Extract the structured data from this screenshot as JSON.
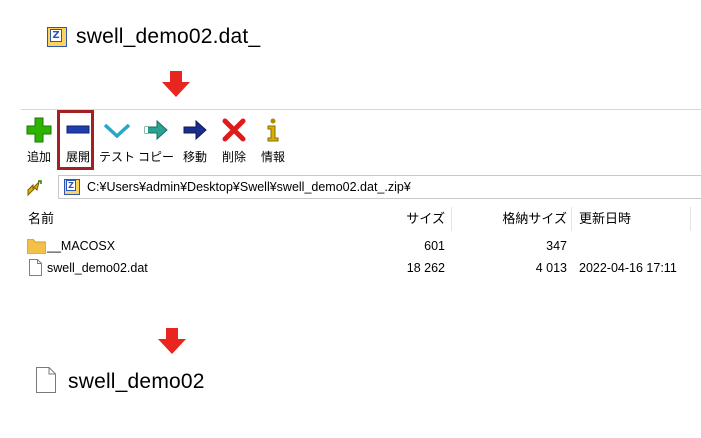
{
  "top_archive": {
    "filename": "swell_demo02.dat_"
  },
  "toolbar": {
    "buttons": [
      {
        "label": "追加",
        "icon": "add-plus-icon"
      },
      {
        "label": "展開",
        "icon": "extract-minus-icon"
      },
      {
        "label": "テスト",
        "icon": "test-check-icon"
      },
      {
        "label": "コピー",
        "icon": "copy-arrow-icon"
      },
      {
        "label": "移動",
        "icon": "move-arrow-icon"
      },
      {
        "label": "削除",
        "icon": "delete-x-icon"
      },
      {
        "label": "情報",
        "icon": "info-icon"
      }
    ],
    "highlighted_button": "展開",
    "highlight_color": "#a31f24"
  },
  "address_bar": {
    "path": "C:¥Users¥admin¥Desktop¥Swell¥swell_demo02.dat_.zip¥"
  },
  "file_list": {
    "columns": [
      "名前",
      "サイズ",
      "格納サイズ",
      "更新日時"
    ],
    "rows": [
      {
        "name": "__MACOSX",
        "type": "folder",
        "size": "601",
        "packed": "347",
        "modified": ""
      },
      {
        "name": "swell_demo02.dat",
        "type": "file",
        "size": "18 262",
        "packed": "4 013",
        "modified": "2022-04-16 17:11"
      }
    ]
  },
  "result_file": {
    "filename": "swell_demo02"
  },
  "colors": {
    "arrow_red": "#e8251f",
    "add_green": "#2db300",
    "extract_blue": "#1f3fae"
  }
}
